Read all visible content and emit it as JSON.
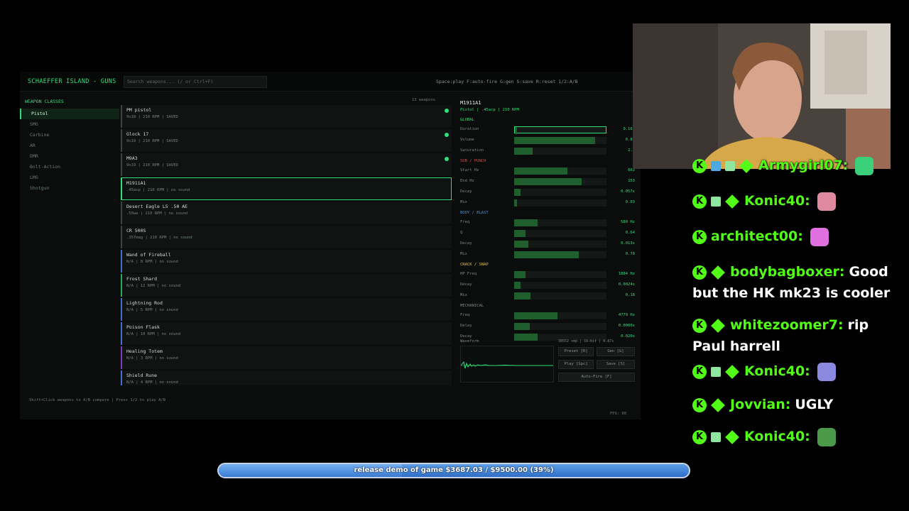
{
  "app": {
    "title": "SCHAEFFER ISLAND - GUNS",
    "search_placeholder": "Search weapons... (/ or Ctrl+F)",
    "shortcuts": "Space:play  F:auto-fire  G:gen  S:save  R:reset  1/2:A/B",
    "footer_hint": "Shift+Click weapons to A/B compare  |  Press 1/2 to play A/B",
    "fps": "FPS: 60"
  },
  "classes": {
    "header": "WEAPON CLASSES",
    "items": [
      "Pistol",
      "SMG",
      "Carbine",
      "AR",
      "DMR",
      "Bolt-Action",
      "LMG",
      "Shotgun"
    ],
    "selected": "Pistol"
  },
  "weapons": {
    "count_label": "13 weapons",
    "items": [
      {
        "name": "PM pistol",
        "detail": "9x18  |  210 RPM  |  SAVED",
        "saved": true,
        "color": "#3a4441"
      },
      {
        "name": "Glock 17",
        "detail": "9x19  |  210 RPM  |  SAVED",
        "saved": true,
        "color": "#3a4441"
      },
      {
        "name": "M9A3",
        "detail": "9x19  |  210 RPM  |  SAVED",
        "saved": true,
        "color": "#3a4441"
      },
      {
        "name": "M1911A1",
        "detail": ".45acp  |  210 RPM  |  no sound",
        "saved": false,
        "color": "#2fe07a",
        "selected": true
      },
      {
        "name": "Desert Eagle L5 .50 AE",
        "detail": ".50ae  |  210 RPM  |  no sound",
        "saved": false,
        "color": "#3a4441"
      },
      {
        "name": "CR 500S",
        "detail": ".357mag  |  210 RPM  |  no sound",
        "saved": false,
        "color": "#3a4441"
      },
      {
        "name": "Wand of Fireball",
        "detail": "N/A  |  8 RPM  |  no sound",
        "saved": false,
        "color": "#3f6fd0"
      },
      {
        "name": "Frost Shard",
        "detail": "N/A  |  12 RPM  |  no sound",
        "saved": false,
        "color": "#2fa85a"
      },
      {
        "name": "Lightning Rod",
        "detail": "N/A  |  5 RPM  |  no sound",
        "saved": false,
        "color": "#3f6fd0"
      },
      {
        "name": "Poison Flask",
        "detail": "N/A  |  10 RPM  |  no sound",
        "saved": false,
        "color": "#3f6fd0"
      },
      {
        "name": "Healing Totem",
        "detail": "N/A  |  3 RPM  |  no sound",
        "saved": false,
        "color": "#7a3fc0"
      },
      {
        "name": "Shield Rune",
        "detail": "N/A  |  4 RPM  |  no sound",
        "saved": false,
        "color": "#3f6fd0"
      }
    ]
  },
  "synth": {
    "name": "M1911A1",
    "subtitle": "Pistol  |  .45acp  |  210 RPM",
    "sections": [
      {
        "title": "GLOBAL",
        "color": "#2fe07a",
        "params": [
          {
            "label": "Duration",
            "fill": 0.02,
            "value": "0.16s",
            "highlight": true
          },
          {
            "label": "Volume",
            "fill": 0.88,
            "value": "0.88"
          },
          {
            "label": "Saturation",
            "fill": 0.2,
            "value": "2.5"
          }
        ]
      },
      {
        "title": "SUB / PUNCH",
        "color": "#e04848",
        "params": [
          {
            "label": "Start Hz",
            "fill": 0.58,
            "value": "663"
          },
          {
            "label": "End Hz",
            "fill": 0.73,
            "value": "153"
          },
          {
            "label": "Decay",
            "fill": 0.07,
            "value": "0.057s"
          },
          {
            "label": "Mix",
            "fill": 0.03,
            "value": "0.03"
          }
        ]
      },
      {
        "title": "BODY / BLAST",
        "color": "#3f8fe0",
        "params": [
          {
            "label": "Freq",
            "fill": 0.25,
            "value": "580 Hz"
          },
          {
            "label": "Q",
            "fill": 0.12,
            "value": "0.64"
          },
          {
            "label": "Decay",
            "fill": 0.15,
            "value": "0.013s"
          },
          {
            "label": "Mix",
            "fill": 0.7,
            "value": "0.70"
          }
        ]
      },
      {
        "title": "CRACK / SNAP",
        "color": "#e0c040",
        "params": [
          {
            "label": "HP Freq",
            "fill": 0.12,
            "value": "1884 Hz"
          },
          {
            "label": "Decay",
            "fill": 0.07,
            "value": "0.0024s"
          },
          {
            "label": "Mix",
            "fill": 0.18,
            "value": "0.18"
          }
        ]
      },
      {
        "title": "MECHANICAL",
        "color": "#7b8682",
        "params": [
          {
            "label": "Freq",
            "fill": 0.47,
            "value": "4779 Hz"
          },
          {
            "label": "Delay",
            "fill": 0.17,
            "value": "0.0060s"
          },
          {
            "label": "Decay",
            "fill": 0.25,
            "value": "0.020s"
          }
        ]
      }
    ],
    "waveform_label": "Waveform",
    "sample_rate": "38552 smp | 16-bit | 0.87s",
    "buttons": {
      "preset": "Preset [R]",
      "gen": "Gen [G]",
      "play": "Play [Spc]",
      "save": "Save [S]",
      "autofire": "Auto-Fire [F]"
    }
  },
  "chat": [
    {
      "user": "Armygirl07:",
      "text": "",
      "badges": [
        "kick",
        "sword",
        "gift",
        "sub"
      ],
      "emote": "cat-emote"
    },
    {
      "user": "Konic40:",
      "text": "",
      "badges": [
        "kick",
        "gift",
        "sub"
      ],
      "emote": "hand-emote"
    },
    {
      "user": "architect00:",
      "text": "",
      "badges": [
        "kick"
      ],
      "emote": "dj-emote"
    },
    {
      "user": "bodybagboxer:",
      "text": "Good but the HK mk23 is cooler",
      "badges": [
        "kick",
        "sub"
      ]
    },
    {
      "user": "whitezoomer7:",
      "text": "rip Paul harrell",
      "badges": [
        "kick",
        "sub"
      ]
    },
    {
      "user": "Konic40:",
      "text": "",
      "badges": [
        "kick",
        "gift",
        "sub"
      ],
      "emote": "brush-emote"
    },
    {
      "user": "Jovvian:",
      "text": "UGLY",
      "badges": [
        "kick",
        "sub"
      ]
    },
    {
      "user": "Konic40:",
      "text": "",
      "badges": [
        "kick",
        "gift",
        "sub"
      ],
      "emote": "frog-emote"
    }
  ],
  "goal": {
    "text": "release demo of game $3687.03 / $9500.00 (39%)",
    "progress": 0.39
  },
  "colors": {
    "accent": "#2fe07a",
    "kick_green": "#53fc18",
    "goal_blue": "#2f6ec8"
  }
}
